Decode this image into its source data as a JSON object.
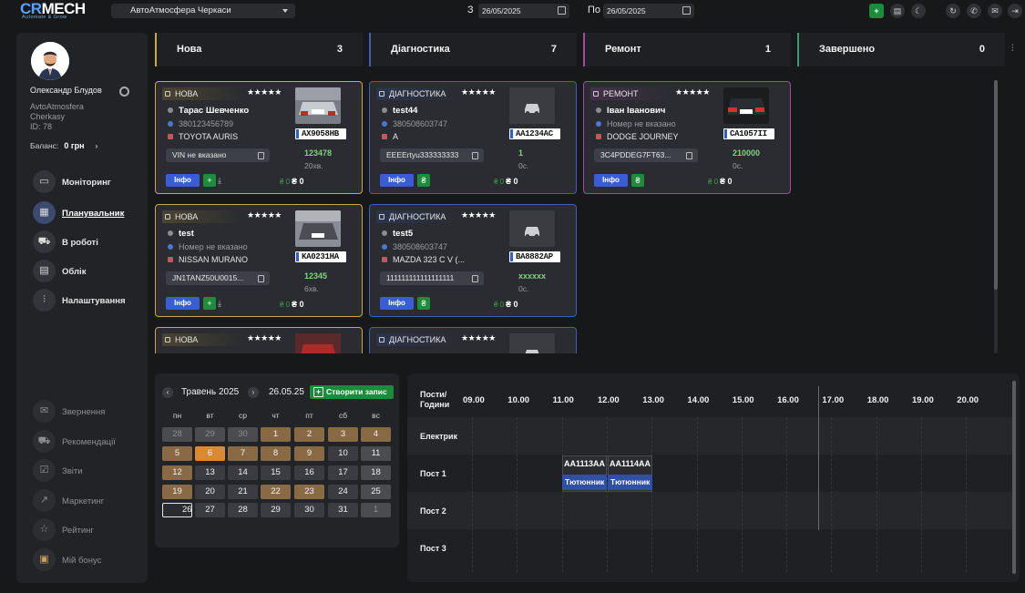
{
  "app": {
    "logo_main": "CRMECH",
    "logo_accent": "CR",
    "logo_rest": "MECH",
    "logo_tagline": "Automate & Grow"
  },
  "topbar": {
    "branch_select": "АвтоАтмосфера Черкаси",
    "date_from_label": "З",
    "date_from": "26/05/2025",
    "date_to_label": "По",
    "date_to": "26/05/2025",
    "icons": [
      "add-icon",
      "archive-icon",
      "theme-icon",
      "refresh-icon",
      "phone-icon",
      "chat-icon",
      "logout-icon"
    ]
  },
  "sidebar": {
    "user_name": "Олександр Блудов",
    "company": "AvtoAtmosfera",
    "city": "Cherkasy",
    "id_label": "ID: 78",
    "balance_label": "Баланс:",
    "balance_value": "0 грн",
    "nav": [
      {
        "label": "Моніторинг",
        "icon": "monitor-icon"
      },
      {
        "label": "Планувальник",
        "icon": "planner-icon",
        "active": true
      },
      {
        "label": "В роботі",
        "icon": "car-icon"
      },
      {
        "label": "Облік",
        "icon": "document-icon"
      },
      {
        "label": "Налаштування",
        "icon": "sliders-icon"
      }
    ],
    "nav_secondary": [
      {
        "label": "Звернення",
        "icon": "chat-icon"
      },
      {
        "label": "Рекомендації",
        "icon": "car-icon"
      },
      {
        "label": "Звіти",
        "icon": "report-icon"
      },
      {
        "label": "Маркетинг",
        "icon": "chart-icon"
      },
      {
        "label": "Рейтинг",
        "icon": "star-icon"
      },
      {
        "label": "Мій бонус",
        "icon": "gift-icon"
      }
    ]
  },
  "columns": [
    {
      "title": "Нова",
      "count": "3",
      "color": "#c9a84a"
    },
    {
      "title": "Діагностика",
      "count": "7",
      "color": "#3f5fb8"
    },
    {
      "title": "Ремонт",
      "count": "1",
      "color": "#a04aa8"
    },
    {
      "title": "Завершено",
      "count": "0",
      "color": "#3a9a6a"
    }
  ],
  "cards": [
    {
      "status": "НОВА",
      "stars": "★★★★★",
      "name": "Тарас Шевченко",
      "phone": "380123456789",
      "car": "TOYOTA AURIS",
      "plate": "AX9058HB",
      "vin": "VIN не вказано",
      "sum": "123478",
      "time": "20хв.",
      "info": "Інфо",
      "gv": "₴ 0",
      "wv": "₴ 0"
    },
    {
      "status": "ДІАГНОСТИКА",
      "stars": "★★★★★",
      "name": "test44",
      "phone": "380508603747",
      "car": "A",
      "plate": "AA1234AC",
      "vin": "EEEErtyu333333333",
      "sum": "1",
      "time": "0с.",
      "info": "Інфо",
      "gv": "₴ 0",
      "wv": "₴ 0"
    },
    {
      "status": "РЕМОНТ",
      "stars": "★★★★★",
      "name": "Іван Іванович",
      "phone": "Номер не вказано",
      "car": "DODGE JOURNEY",
      "plate": "CA1057II",
      "vin": "3C4PDDEG7FT63...",
      "sum": "210000",
      "time": "0с.",
      "info": "Інфо",
      "gv": "₴ 0",
      "wv": "₴ 0"
    },
    {
      "status": "НОВА",
      "stars": "★★★★★",
      "name": "test",
      "phone": "Номер не вказано",
      "car": "NISSAN MURANO",
      "plate": "KA0231HA",
      "vin": "JN1TANZ50U0015...",
      "sum": "12345",
      "time": "6хв.",
      "info": "Інфо",
      "gv": "₴ 0",
      "wv": "₴ 0"
    },
    {
      "status": "ДІАГНОСТИКА",
      "stars": "★★★★★",
      "name": "test5",
      "phone": "380508603747",
      "car": "MAZDA 323 C V (...",
      "plate": "BA8882AP",
      "vin": "111111111111111111",
      "sum": "xxxxxx",
      "time": "0с.",
      "info": "Інфо",
      "gv": "₴ 0",
      "wv": "₴ 0"
    },
    {
      "status": "НОВА",
      "stars": "★★★★★"
    },
    {
      "status": "ДІАГНОСТИКА",
      "stars": "★★★★★"
    }
  ],
  "calendar": {
    "month": "Травень 2025",
    "selected_date": "26.05.25",
    "create_button": "Створити запис",
    "weekdays": [
      "пн",
      "вт",
      "ср",
      "чт",
      "пт",
      "сб",
      "вс"
    ],
    "days": [
      [
        "28",
        "29",
        "30",
        "1",
        "2",
        "3",
        "4"
      ],
      [
        "5",
        "6",
        "7",
        "8",
        "9",
        "10",
        "11"
      ],
      [
        "12",
        "13",
        "14",
        "15",
        "16",
        "17",
        "18"
      ],
      [
        "19",
        "20",
        "21",
        "22",
        "23",
        "24",
        "25"
      ],
      [
        "26",
        "27",
        "28",
        "29",
        "30",
        "31",
        "1"
      ]
    ]
  },
  "schedule": {
    "header": "Пости/ Години",
    "hours": [
      "09.00",
      "10.00",
      "11.00",
      "12.00",
      "13.00",
      "14.00",
      "15.00",
      "16.00",
      "17.00",
      "18.00",
      "19.00",
      "20.00"
    ],
    "posts": [
      "Електрик",
      "Пост 1",
      "Пост 2",
      "Пост 3"
    ],
    "events": [
      {
        "plate": "AA1113AA",
        "name": "Тютюнник"
      },
      {
        "plate": "AA1114AA",
        "name": "Тютюнник"
      }
    ]
  }
}
